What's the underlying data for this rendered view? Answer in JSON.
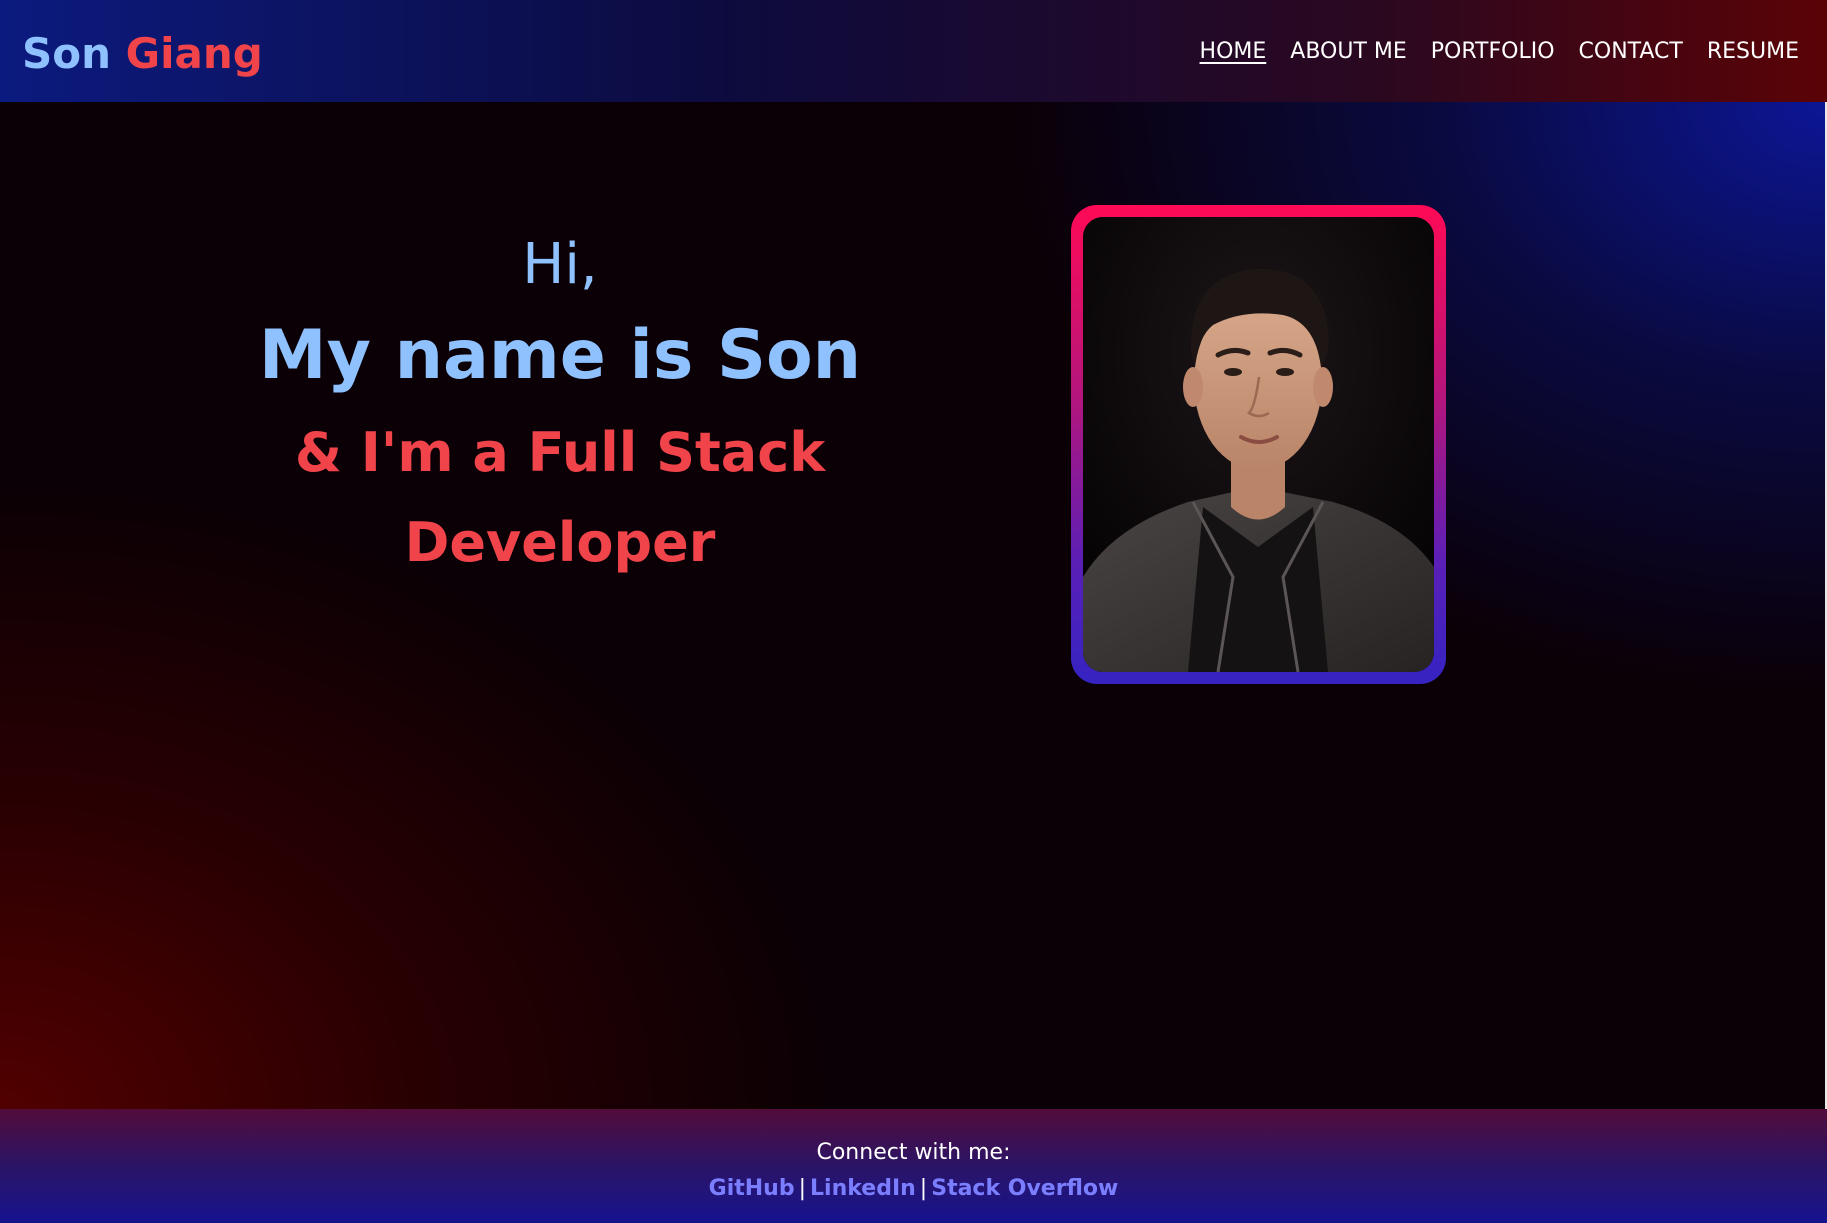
{
  "header": {
    "brand_first": "Son",
    "brand_last": "Giang",
    "nav": [
      {
        "label": "HOME",
        "active": true
      },
      {
        "label": "ABOUT ME",
        "active": false
      },
      {
        "label": "PORTFOLIO",
        "active": false
      },
      {
        "label": "CONTACT",
        "active": false
      },
      {
        "label": "RESUME",
        "active": false
      }
    ]
  },
  "hero": {
    "greeting": "Hi,",
    "name_line": "My name is Son",
    "role_line_1": "& I'm a Full Stack",
    "role_line_2": "Developer",
    "photo_icon": "profile-photo"
  },
  "footer": {
    "label": "Connect with me:",
    "links": [
      "GitHub",
      "LinkedIn",
      "Stack Overflow"
    ],
    "separator": "|"
  },
  "colors": {
    "accent_blue": "#8fc1ff",
    "accent_red": "#f0444a",
    "link": "#7b7fff",
    "frame_top": "#ff0a55",
    "frame_bottom": "#3523c2"
  }
}
